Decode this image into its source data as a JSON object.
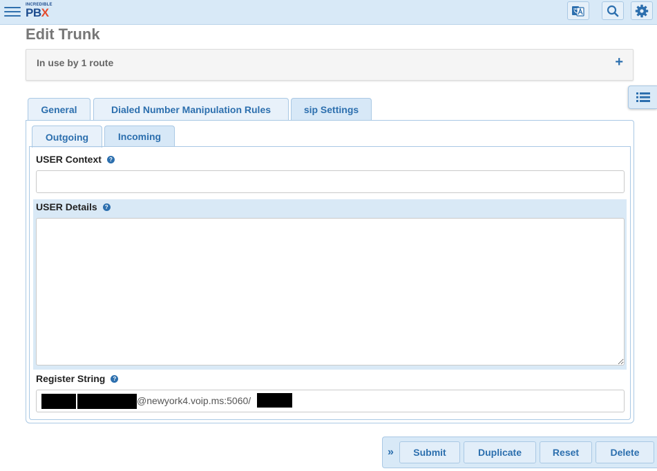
{
  "header": {
    "logo_small": "INCREDIBLE",
    "logo_big": "PB",
    "logo_x": "X",
    "icons": [
      "hamburger-menu-icon",
      "language-icon",
      "search-icon",
      "gear-icon"
    ]
  },
  "page": {
    "title": "Edit Trunk",
    "usage_text": "In use by 1 route",
    "usage_expand": "+"
  },
  "tabs": [
    {
      "label": "General",
      "active": false
    },
    {
      "label": "Dialed Number Manipulation Rules",
      "active": false
    },
    {
      "label": "sip Settings",
      "active": true
    }
  ],
  "subtabs": [
    {
      "label": "Outgoing",
      "active": false
    },
    {
      "label": "Incoming",
      "active": true
    }
  ],
  "fields": {
    "user_context": {
      "label": "USER Context",
      "value": ""
    },
    "user_details": {
      "label": "USER Details",
      "value": ""
    },
    "register_string": {
      "label": "Register String",
      "visible_value": "@newyork4.voip.ms:5060/"
    }
  },
  "help_glyph": "?",
  "actions": {
    "submit": "Submit",
    "duplicate": "Duplicate",
    "reset": "Reset",
    "delete": "Delete",
    "chevrons": "»"
  },
  "colors": {
    "accent": "#2c6fae",
    "header_bg": "#d8e9f7",
    "border": "#a9c8e4"
  }
}
